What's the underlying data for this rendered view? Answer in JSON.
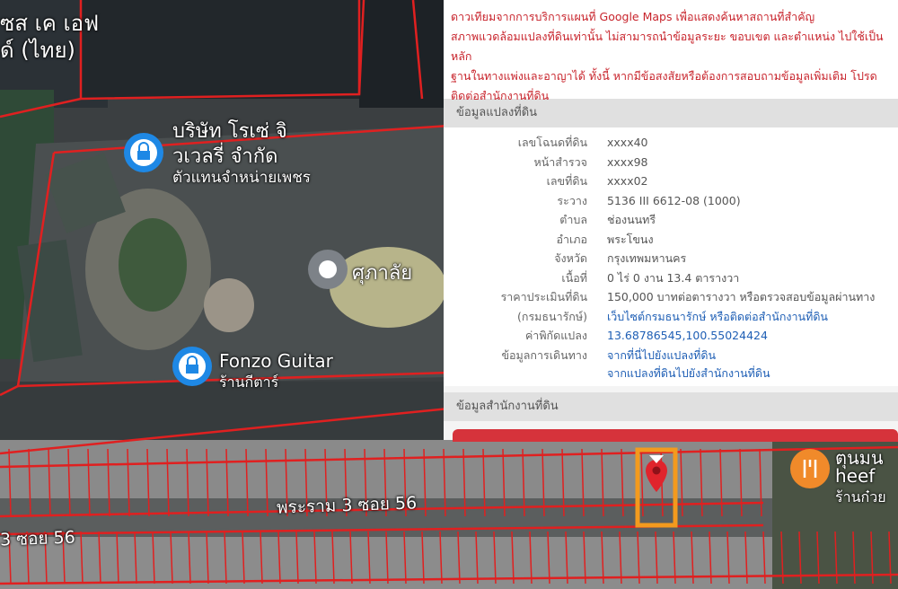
{
  "map": {
    "top_left_label": [
      "ซส เค เอฟ",
      "ด์ (ไทย)"
    ],
    "poi_company": {
      "name": "บริษัท โรเซ่ จิ",
      "line2": "วเวลรี่ จำกัด",
      "sub": "ตัวแทนจำหน่ายเพชร"
    },
    "poi_temple": {
      "name": "ศุภาลัย"
    },
    "poi_guitar": {
      "name": "Fonzo Guitar",
      "sub": "ร้านกีตาร์"
    },
    "poi_restaurant": {
      "name": "ตุนมน",
      "line2": "heef",
      "sub": "ร้านก๋วย"
    },
    "road_main": "พระราม 3 ซอย 56",
    "road_left": "3 ซอย 56",
    "colors": {
      "parcel_line": "#e02020",
      "marker": "#e0242c",
      "highlight": "#f39a1e",
      "restaurant_icon": "#f08a2a"
    }
  },
  "panel": {
    "notice_lines": [
      "ดาวเทียมจากการบริการแผนที่ Google Maps เพื่อแสดงค้นหาสถานที่สำคัญ",
      "สภาพแวดล้อมแปลงที่ดินเท่านั้น ไม่สามารถนำข้อมูลระยะ ขอบเขต และตำแหน่ง ไปใช้เป็นหลัก",
      "ฐานในทางแพ่งและอาญาได้ ทั้งนี้ หากมีข้อสงสัยหรือต้องการสอบถามข้อมูลเพิ่มเติม โปรด",
      "ติดต่อสำนักงานที่ดิน"
    ],
    "section_land": "ข้อมูลแปลงที่ดิน",
    "rows": [
      {
        "k": "เลขโฉนดที่ดิน",
        "v": "xxxx40"
      },
      {
        "k": "หน้าสำรวจ",
        "v": "xxxx98"
      },
      {
        "k": "เลขที่ดิน",
        "v": "xxxx02"
      },
      {
        "k": "ระวาง",
        "v": "5136 III 6612-08 (1000)"
      },
      {
        "k": "ตำบล",
        "v": "ช่องนนทรี"
      },
      {
        "k": "อำเภอ",
        "v": "พระโขนง"
      },
      {
        "k": "จังหวัด",
        "v": "กรุงเทพมหานคร"
      },
      {
        "k": "เนื้อที่",
        "v": "0 ไร่ 0 งาน 13.4 ตารางวา"
      },
      {
        "k": "ราคาประเมินที่ดิน",
        "v": "150,000 บาทต่อตารางวา หรือตรวจสอบข้อมูลผ่านทาง"
      },
      {
        "k": "(กรมธนารักษ์)",
        "v": "เว็บไซต์กรมธนารักษ์ หรือติดต่อสำนักงานที่ดิน",
        "link": true
      },
      {
        "k": "ค่าพิกัดแปลง",
        "v": "13.68786545,100.55024424",
        "link": true
      },
      {
        "k": "ข้อมูลการเดินทาง",
        "v": "จากที่นี่ไปยังแปลงที่ดิน",
        "link": true
      }
    ],
    "route_extra": "จากแปลงที่ดินไปยังสำนักงานที่ดิน",
    "section_office": "ข้อมูลสำนักงานที่ดิน"
  }
}
